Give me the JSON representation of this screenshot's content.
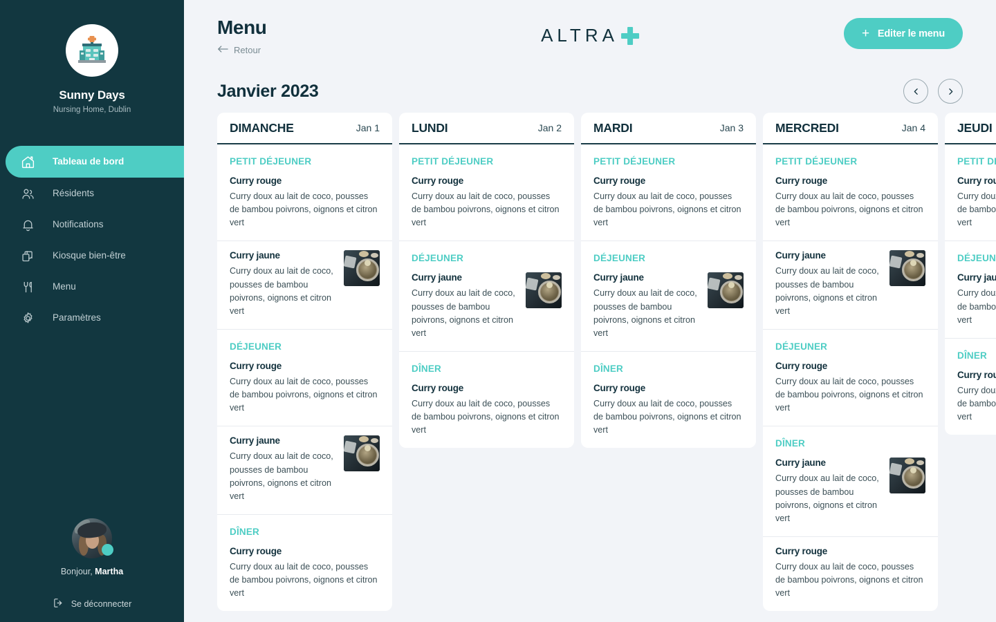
{
  "sidebar": {
    "org_name": "Sunny Days",
    "org_subtitle": "Nursing Home, Dublin",
    "items": [
      {
        "label": "Tableau de bord",
        "icon": "home-icon",
        "active": true
      },
      {
        "label": "Résidents",
        "icon": "users-icon",
        "active": false
      },
      {
        "label": "Notifications",
        "icon": "bell-icon",
        "active": false
      },
      {
        "label": "Kiosque bien-être",
        "icon": "cards-icon",
        "active": false
      },
      {
        "label": "Menu",
        "icon": "cutlery-icon",
        "active": false
      },
      {
        "label": "Paramètres",
        "icon": "gear-icon",
        "active": false
      }
    ],
    "greeting_prefix": "Bonjour, ",
    "user_name": "Martha",
    "logout_label": "Se déconnecter"
  },
  "header": {
    "page_title": "Menu",
    "back_label": "Retour",
    "logo_word": "ALTRA",
    "logo_plus": "+",
    "edit_button_label": "Editer le menu",
    "edit_button_icon": "plus-icon"
  },
  "month": {
    "title": "Janvier 2023",
    "prev_label": "‹",
    "next_label": "›"
  },
  "colors": {
    "accent": "#4ecdc4",
    "sidebar_bg": "#123740",
    "page_bg": "#f2f4f8",
    "heading": "#11303c"
  },
  "dish_variants": {
    "rouge_name": "Curry rouge",
    "jaune_name": "Curry jaune",
    "description": "Curry doux au lait de coco, pousses de bambou poivrons, oignons et citron vert"
  },
  "days": [
    {
      "name": "DIMANCHE",
      "date": "Jan 1",
      "groups": [
        {
          "label": "PETIT DÉJEUNER",
          "dishes": [
            {
              "name": "Curry rouge",
              "desc": "Curry doux au lait de coco, pousses de bambou poivrons, oignons et citron vert",
              "thumb": false
            },
            {
              "name": "Curry jaune",
              "desc": "Curry doux au lait de coco, pousses de bambou poivrons, oignons et citron vert",
              "thumb": true
            }
          ]
        },
        {
          "label": "DÉJEUNER",
          "dishes": [
            {
              "name": "Curry rouge",
              "desc": "Curry doux au lait de coco, pousses de bambou poivrons, oignons et citron vert",
              "thumb": false
            },
            {
              "name": "Curry jaune",
              "desc": "Curry doux au lait de coco, pousses de bambou poivrons, oignons et citron vert",
              "thumb": true
            }
          ]
        },
        {
          "label": "DÎNER",
          "dishes": [
            {
              "name": "Curry rouge",
              "desc": "Curry doux au lait de coco, pousses de bambou poivrons, oignons et citron vert",
              "thumb": false
            }
          ]
        }
      ]
    },
    {
      "name": "LUNDI",
      "date": "Jan 2",
      "groups": [
        {
          "label": "PETIT DÉJEUNER",
          "dishes": [
            {
              "name": "Curry rouge",
              "desc": "Curry doux au lait de coco, pousses de bambou poivrons, oignons et citron vert",
              "thumb": false
            }
          ]
        },
        {
          "label": "DÉJEUNER",
          "dishes": [
            {
              "name": "Curry jaune",
              "desc": "Curry doux au lait de coco, pousses de bambou poivrons, oignons et citron vert",
              "thumb": true
            }
          ]
        },
        {
          "label": "DÎNER",
          "dishes": [
            {
              "name": "Curry rouge",
              "desc": "Curry doux au lait de coco, pousses de bambou poivrons, oignons et citron vert",
              "thumb": false
            }
          ]
        }
      ]
    },
    {
      "name": "MARDI",
      "date": "Jan 3",
      "groups": [
        {
          "label": "PETIT DÉJEUNER",
          "dishes": [
            {
              "name": "Curry rouge",
              "desc": "Curry doux au lait de coco, pousses de bambou poivrons, oignons et citron vert",
              "thumb": false
            }
          ]
        },
        {
          "label": "DÉJEUNER",
          "dishes": [
            {
              "name": "Curry jaune",
              "desc": "Curry doux au lait de coco, pousses de bambou poivrons, oignons et citron vert",
              "thumb": true
            }
          ]
        },
        {
          "label": "DÎNER",
          "dishes": [
            {
              "name": "Curry rouge",
              "desc": "Curry doux au lait de coco, pousses de bambou poivrons, oignons et citron vert",
              "thumb": false
            }
          ]
        }
      ]
    },
    {
      "name": "MERCREDI",
      "date": "Jan 4",
      "groups": [
        {
          "label": "PETIT DÉJEUNER",
          "dishes": [
            {
              "name": "Curry rouge",
              "desc": "Curry doux au lait de coco, pousses de bambou poivrons, oignons et citron vert",
              "thumb": false
            },
            {
              "name": "Curry jaune",
              "desc": "Curry doux au lait de coco, pousses de bambou poivrons, oignons et citron vert",
              "thumb": true
            }
          ]
        },
        {
          "label": "DÉJEUNER",
          "dishes": [
            {
              "name": "Curry rouge",
              "desc": "Curry doux au lait de coco, pousses de bambou poivrons, oignons et citron vert",
              "thumb": false
            }
          ]
        },
        {
          "label": "DÎNER",
          "dishes": [
            {
              "name": "Curry jaune",
              "desc": "Curry doux au lait de coco, pousses de bambou poivrons, oignons et citron vert",
              "thumb": true
            },
            {
              "name": "Curry rouge",
              "desc": "Curry doux au lait de coco, pousses de bambou poivrons, oignons et citron vert",
              "thumb": false
            }
          ]
        }
      ]
    },
    {
      "name": "JEUDI",
      "date": "",
      "groups": [
        {
          "label": "PETIT DÉJEUNER",
          "dishes": [
            {
              "name": "Curry rouge",
              "desc": "Curry doux au lait de coco, pousses de bambou poivrons, oignons et citron vert",
              "thumb": false
            }
          ]
        },
        {
          "label": "DÉJEUNER",
          "dishes": [
            {
              "name": "Curry jaune",
              "desc": "Curry doux au lait de coco, pousses de bambou poivrons, oignons et citron vert",
              "thumb": false
            }
          ]
        },
        {
          "label": "DÎNER",
          "dishes": [
            {
              "name": "Curry rouge",
              "desc": "Curry doux au lait de coco, pousses de bambou poivrons, oignons et citron vert",
              "thumb": false
            }
          ]
        }
      ]
    }
  ]
}
